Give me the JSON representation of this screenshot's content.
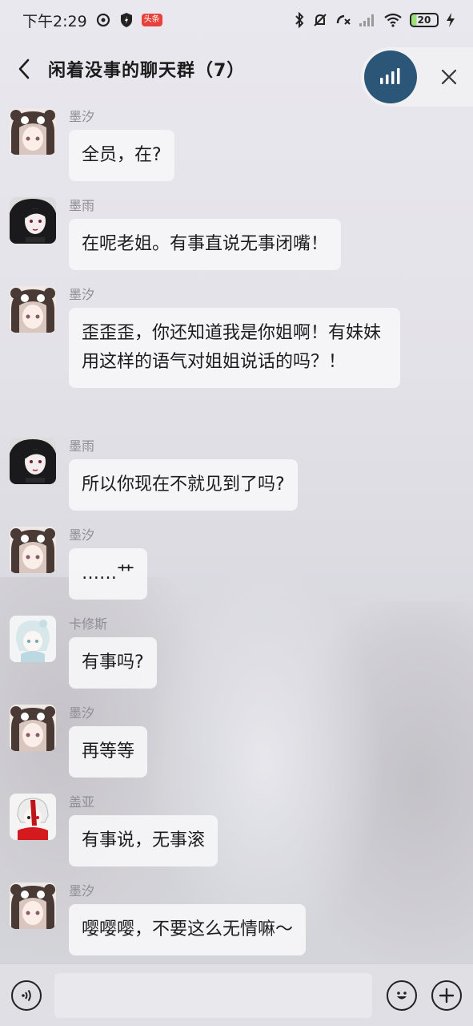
{
  "status_bar": {
    "time": "下午2:29",
    "toutiao_badge": "头条",
    "battery": "20",
    "icons": [
      "sync-icon",
      "shield-icon",
      "toutiao-app-icon",
      "bluetooth-icon",
      "mute-bell-icon",
      "missed-call-icon",
      "signal-icon",
      "wifi-icon",
      "battery-icon",
      "charging-icon"
    ]
  },
  "header": {
    "title": "闲着没事的聊天群（7）",
    "back_icon": "chevron-left-icon",
    "voice_icon": "voice-bars-icon",
    "close_icon": "close-icon"
  },
  "messages": [
    {
      "sender": "墨汐",
      "text": "全员，在?",
      "avatar": "girl-bear-hood-avatar"
    },
    {
      "sender": "墨雨",
      "text": "在呢老姐。有事直说无事闭嘴！",
      "avatar": "dark-hair-girl-avatar"
    },
    {
      "sender": "墨汐",
      "text": "歪歪歪，你还知道我是你姐啊！有妹妹用这样的语气对姐姐说话的吗？！",
      "avatar": "girl-bear-hood-avatar"
    },
    {
      "sender": "墨雨",
      "text": "所以你现在不就见到了吗?",
      "avatar": "dark-hair-girl-avatar"
    },
    {
      "sender": "墨汐",
      "text": "……艹",
      "avatar": "girl-bear-hood-avatar"
    },
    {
      "sender": "卡修斯",
      "text": "有事吗?",
      "avatar": "white-hair-boy-avatar"
    },
    {
      "sender": "墨汐",
      "text": "再等等",
      "avatar": "girl-bear-hood-avatar"
    },
    {
      "sender": "盖亚",
      "text": "有事说，无事滚",
      "avatar": "red-white-boy-avatar"
    },
    {
      "sender": "墨汐",
      "text": "嘤嘤嘤，不要这么无情嘛～",
      "avatar": "girl-bear-hood-avatar"
    }
  ],
  "input_bar": {
    "placeholder": "",
    "voice_icon": "voice-input-icon",
    "emoji_icon": "emoji-icon",
    "plus_icon": "plus-icon"
  },
  "colors": {
    "voice_button": "#2c5677",
    "bubble": "#f6f6f9",
    "sender_text": "#8d8d93"
  }
}
